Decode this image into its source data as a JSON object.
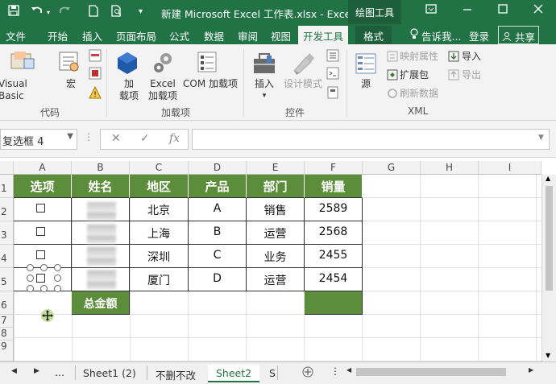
{
  "titlebar": {
    "title": "新建 Microsoft Excel 工作表.xlsx - Excel",
    "context_tab": "绘图工具",
    "icons": [
      "save-icon",
      "undo-icon",
      "redo-icon",
      "new-file-icon",
      "print-preview-icon",
      "customize-icon"
    ]
  },
  "tabs": [
    {
      "label": "文件"
    },
    {
      "label": "开始"
    },
    {
      "label": "插入"
    },
    {
      "label": "页面布局"
    },
    {
      "label": "公式"
    },
    {
      "label": "数据"
    },
    {
      "label": "审阅"
    },
    {
      "label": "视图"
    },
    {
      "label": "开发工具"
    },
    {
      "label": "格式"
    }
  ],
  "tab_right": {
    "tell_me": "告诉我...",
    "login": "登录",
    "share": "共享"
  },
  "ribbon": {
    "code": {
      "visual_basic": "Visual Basic",
      "macro": "宏",
      "group": "代码"
    },
    "addins": {
      "add": "加",
      "add2": "载项",
      "excel1": "Excel",
      "excel2": "加载项",
      "com": "COM 加载项",
      "group": "加载项"
    },
    "controls": {
      "insert": "插入",
      "design": "设计模式",
      "group": "控件"
    },
    "source": "源",
    "xml": {
      "map_props": "映射属性",
      "ext_pack": "扩展包",
      "refresh": "刷新数据",
      "import": "导入",
      "export": "导出",
      "group": "XML"
    }
  },
  "formula_bar": {
    "name_box": "复选框 4",
    "cancel": "✕",
    "enter": "✓",
    "fx": "fx",
    "value": ""
  },
  "grid": {
    "columns": [
      "A",
      "B",
      "C",
      "D",
      "E",
      "F",
      "G",
      "H",
      "I"
    ],
    "rows": [
      "1",
      "2",
      "3",
      "4",
      "5",
      "6",
      "7",
      "8",
      "9"
    ],
    "headers": [
      "选项",
      "姓名",
      "地区",
      "产品",
      "部门",
      "销量"
    ],
    "data": [
      {
        "region": "北京",
        "product": "A",
        "dept": "销售",
        "sales": "2589"
      },
      {
        "region": "上海",
        "product": "B",
        "dept": "运营",
        "sales": "2568"
      },
      {
        "region": "深圳",
        "product": "C",
        "dept": "业务",
        "sales": "2455"
      },
      {
        "region": "厦门",
        "product": "D",
        "dept": "运营",
        "sales": "2454"
      }
    ],
    "total_label": "总金额",
    "total_value": ""
  },
  "sheets": {
    "nav_more": "...",
    "tabs": [
      {
        "label": "Sheet1 (2)"
      },
      {
        "label": "不删不改"
      },
      {
        "label": "Sheet2"
      },
      {
        "label": "S"
      }
    ],
    "active": "Sheet2"
  },
  "colors": {
    "brand": "#217346",
    "header_fill": "#5b8d3a"
  }
}
